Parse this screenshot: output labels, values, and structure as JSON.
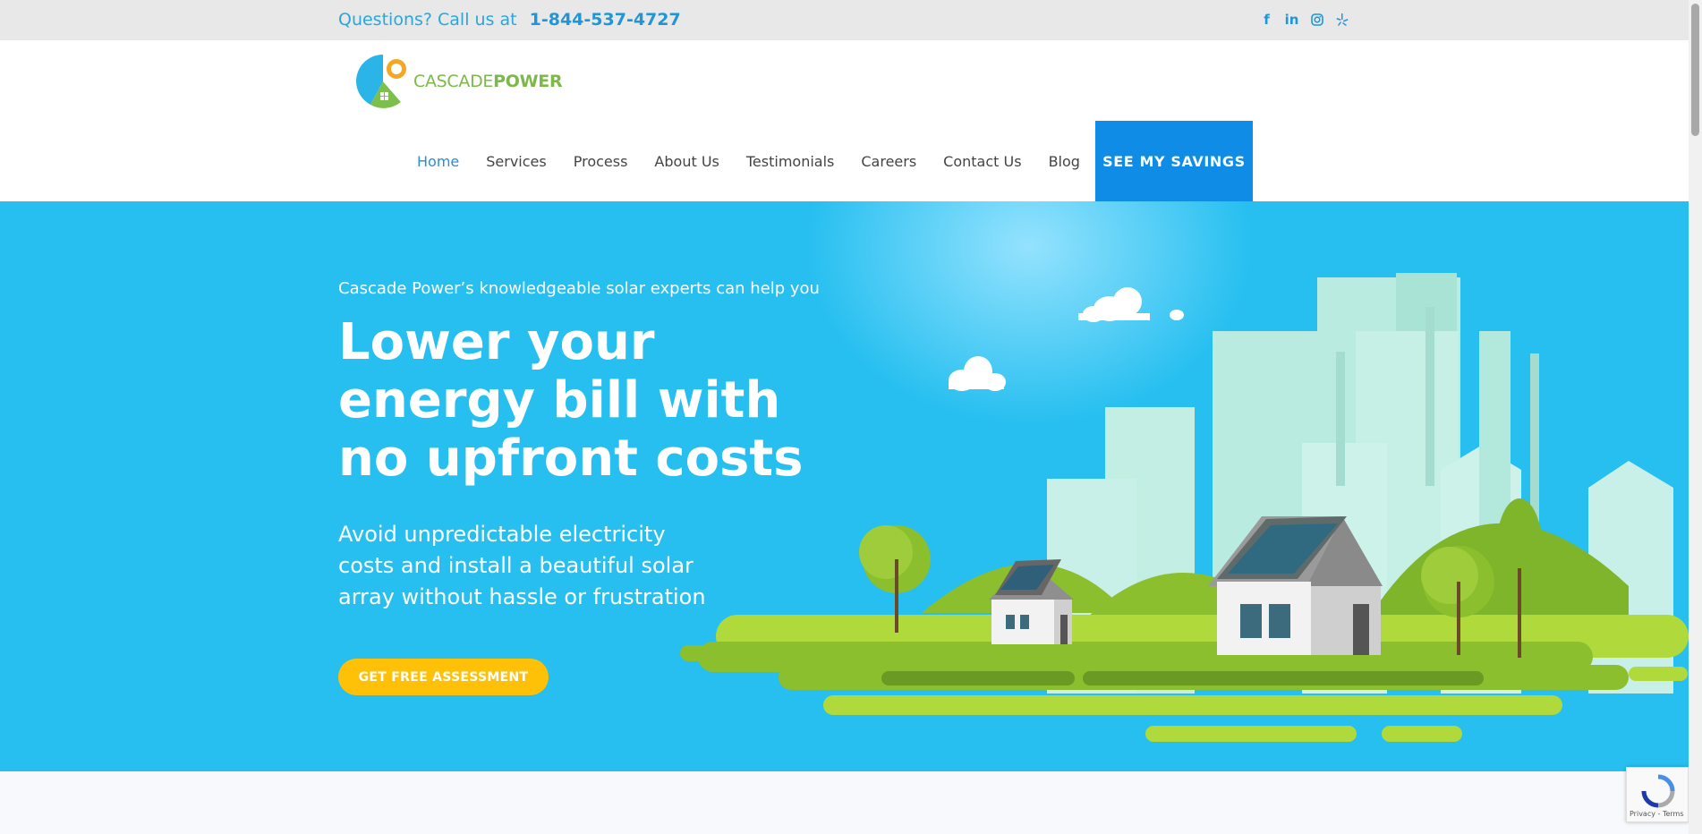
{
  "topbar": {
    "question": "Questions? Call us at",
    "phone": "1-844-537-4727",
    "social": [
      "facebook-icon",
      "linkedin-icon",
      "instagram-icon",
      "yelp-icon"
    ]
  },
  "logo": {
    "part1": "CASCADE",
    "part2": "POWER"
  },
  "nav": {
    "items": [
      "Home",
      "Services",
      "Process",
      "About Us",
      "Testimonials",
      "Careers",
      "Contact Us",
      "Blog"
    ],
    "cta": "SEE MY SAVINGS"
  },
  "hero": {
    "kicker": "Cascade Power’s knowledgeable solar experts can help you",
    "title_line1": "Lower your",
    "title_line2": "energy bill with",
    "title_line3": "no upfront costs",
    "desc_line1": "Avoid unpredictable electricity",
    "desc_line2": "costs and install a beautiful solar",
    "desc_line3": "array without hassle or frustration",
    "button": "GET FREE ASSESSMENT"
  },
  "recaptcha": {
    "terms": "Privacy - Terms"
  },
  "colors": {
    "hero_bg": "#26bff0",
    "accent": "#0e8ce6",
    "button": "#ffc107",
    "brand_green": "#7cb94a"
  }
}
